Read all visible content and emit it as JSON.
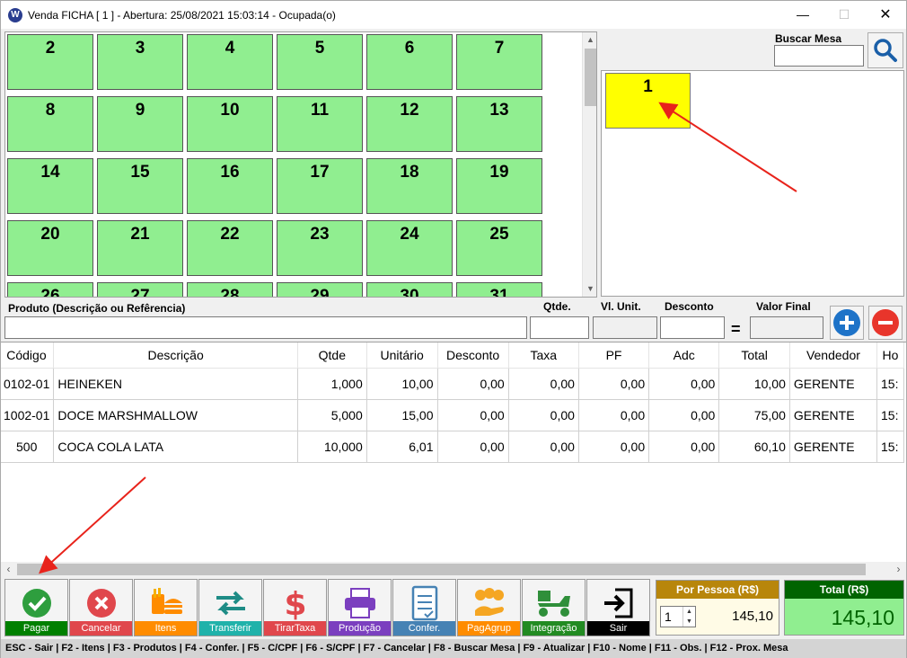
{
  "window": {
    "title": "Venda FICHA [ 1 ] - Abertura: 25/08/2021 15:03:14 - Ocupada(o)",
    "app_icon": "W",
    "minimize": "—",
    "maximize": "☐",
    "close": "✕"
  },
  "tables": [
    "2",
    "3",
    "4",
    "5",
    "6",
    "7",
    "8",
    "9",
    "10",
    "11",
    "12",
    "13",
    "14",
    "15",
    "16",
    "17",
    "18",
    "19",
    "20",
    "21",
    "22",
    "23",
    "24",
    "25",
    "26",
    "27",
    "28",
    "29",
    "30",
    "31"
  ],
  "search": {
    "label": "Buscar Mesa",
    "value": ""
  },
  "occupied_tables": [
    "1"
  ],
  "product_entry": {
    "product_label": "Produto (Descrição ou Refêrencia)",
    "qty_label": "Qtde.",
    "unit_label": "Vl. Unit.",
    "discount_label": "Desconto",
    "final_label": "Valor Final",
    "equals": "="
  },
  "grid": {
    "columns": [
      "Código",
      "Descrição",
      "Qtde",
      "Unitário",
      "Desconto",
      "Taxa",
      "PF",
      "Adc",
      "Total",
      "Vendedor",
      "Ho"
    ],
    "rows": [
      [
        "0102-01",
        "HEINEKEN",
        "1,000",
        "10,00",
        "0,00",
        "0,00",
        "0,00",
        "0,00",
        "10,00",
        "GERENTE",
        "15:"
      ],
      [
        "1002-01",
        "DOCE MARSHMALLOW",
        "5,000",
        "15,00",
        "0,00",
        "0,00",
        "0,00",
        "0,00",
        "75,00",
        "GERENTE",
        "15:"
      ],
      [
        "500",
        "COCA COLA LATA",
        "10,000",
        "6,01",
        "0,00",
        "0,00",
        "0,00",
        "0,00",
        "60,10",
        "GERENTE",
        "15:"
      ]
    ]
  },
  "toolbar": [
    {
      "label": "Pagar",
      "color": "#008000",
      "icon": "check-circle-icon"
    },
    {
      "label": "Cancelar",
      "color": "#e0474c",
      "icon": "x-circle-icon"
    },
    {
      "label": "Itens",
      "color": "#ff8c00",
      "icon": "burger-fries-icon"
    },
    {
      "label": "Transferir",
      "color": "#20b2aa",
      "icon": "swap-arrows-icon"
    },
    {
      "label": "TirarTaxa",
      "color": "#e0474c",
      "icon": "dollar-icon"
    },
    {
      "label": "Produção",
      "color": "#7b3fbf",
      "icon": "printer-icon"
    },
    {
      "label": "Confer.",
      "color": "#4682b4",
      "icon": "checklist-icon"
    },
    {
      "label": "PagAgrup",
      "color": "#ff8c00",
      "icon": "coins-hand-icon"
    },
    {
      "label": "Integração",
      "color": "#228b22",
      "icon": "delivery-scooter-icon"
    },
    {
      "label": "Sair",
      "color": "#000000",
      "icon": "exit-icon"
    }
  ],
  "per_person": {
    "label": "Por Pessoa (R$)",
    "people": "1",
    "value": "145,10"
  },
  "total": {
    "label": "Total (R$)",
    "value": "145,10"
  },
  "status_bar": "ESC - Sair  |  F2 - Itens  |  F3 - Produtos  |  F4 - Confer.  |  F5 - C/CPF  |  F6 - S/CPF  |  F7 - Cancelar  |  F8 - Buscar Mesa  |  F9 - Atualizar  |  F10 - Nome  |  F11 - Obs.  |  F12 - Prox. Mesa",
  "colors": {
    "free_table": "#90ee90",
    "occupied_table": "#ffff00",
    "annotation_arrow": "#e8231b"
  }
}
